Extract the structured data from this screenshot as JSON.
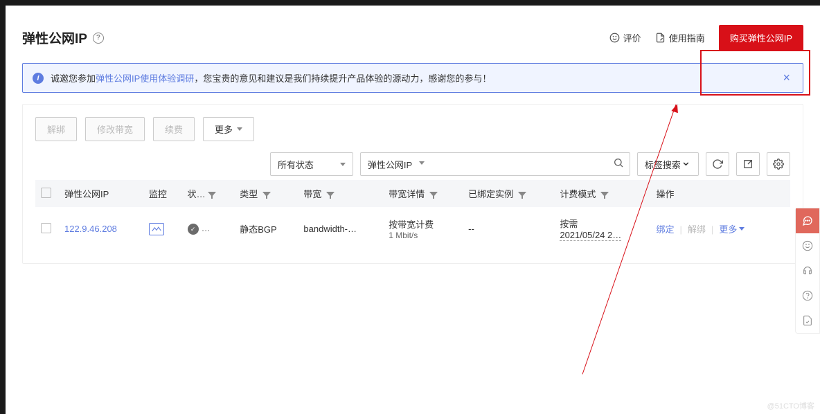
{
  "header": {
    "title": "弹性公网IP",
    "review": "评价",
    "guide": "使用指南",
    "buy_button": "购买弹性公网IP"
  },
  "notice": {
    "prefix": "诚邀您参加",
    "link": "弹性公网IP使用体验调研",
    "suffix": "，您宝贵的意见和建议是我们持续提升产品体验的源动力，感谢您的参与！"
  },
  "actions": {
    "unbind": "解绑",
    "modify_bw": "修改带宽",
    "renew": "续费",
    "more": "更多"
  },
  "filters": {
    "status": "所有状态",
    "search_type": "弹性公网IP",
    "tag_search": "标签搜索"
  },
  "table": {
    "headers": {
      "ip": "弹性公网IP",
      "monitor": "监控",
      "status": "状…",
      "type": "类型",
      "bandwidth": "带宽",
      "bw_detail": "带宽详情",
      "bound_instance": "已绑定实例",
      "billing": "计费模式",
      "ops": "操作"
    },
    "rows": [
      {
        "ip": "122.9.46.208",
        "type": "静态BGP",
        "bandwidth": "bandwidth-…",
        "bw_detail_line1": "按带宽计费",
        "bw_detail_line2": "1 Mbit/s",
        "bound": "--",
        "billing_line1": "按需",
        "billing_line2": "2021/05/24 2…"
      }
    ],
    "row_ops": {
      "bind": "绑定",
      "unbind": "解绑",
      "more": "更多"
    }
  },
  "watermark": "@51CTO博客"
}
